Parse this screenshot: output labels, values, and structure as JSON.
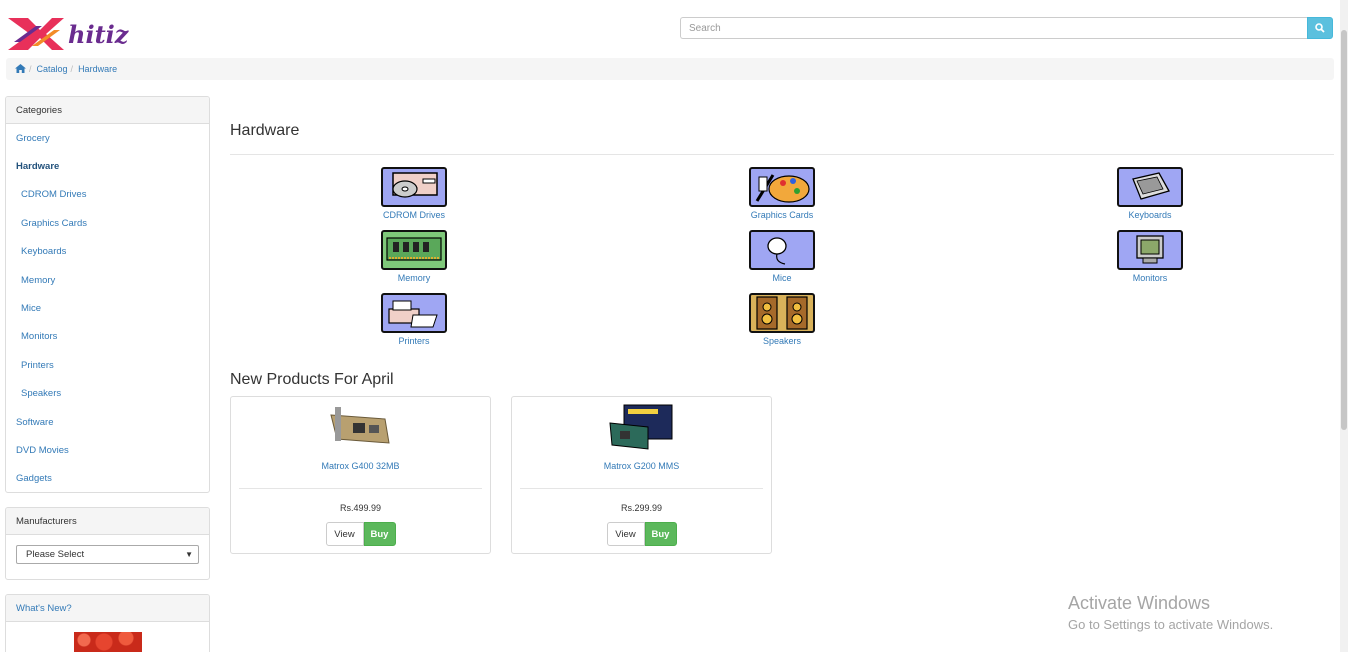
{
  "logo": {
    "text": "hitiz",
    "icon": "brand-x-logo"
  },
  "search": {
    "placeholder": "Search",
    "value": "",
    "icon": "search-icon"
  },
  "breadcrumb": {
    "home_icon": "home-icon",
    "items": [
      "Catalog",
      "Hardware"
    ]
  },
  "categories": {
    "heading": "Categories",
    "items": [
      {
        "label": "Grocery"
      },
      {
        "label": "Hardware"
      },
      {
        "label": "CDROM Drives"
      },
      {
        "label": "Graphics Cards"
      },
      {
        "label": "Keyboards"
      },
      {
        "label": "Memory"
      },
      {
        "label": "Mice"
      },
      {
        "label": "Monitors"
      },
      {
        "label": "Printers"
      },
      {
        "label": "Speakers"
      },
      {
        "label": "Software"
      },
      {
        "label": "DVD Movies"
      },
      {
        "label": "Gadgets"
      }
    ]
  },
  "manufacturers": {
    "heading": "Manufacturers",
    "selected": "Please Select"
  },
  "whats_new": {
    "heading": "What's New?"
  },
  "main": {
    "title": "Hardware",
    "subcategories": [
      {
        "label": "CDROM Drives",
        "icon": "cdrom-drive-icon"
      },
      {
        "label": "Graphics Cards",
        "icon": "graphics-card-icon"
      },
      {
        "label": "Keyboards",
        "icon": "keyboard-icon"
      },
      {
        "label": "Memory",
        "icon": "memory-icon"
      },
      {
        "label": "Mice",
        "icon": "mouse-icon"
      },
      {
        "label": "Monitors",
        "icon": "monitor-icon"
      },
      {
        "label": "Printers",
        "icon": "printer-icon"
      },
      {
        "label": "Speakers",
        "icon": "speakers-icon"
      }
    ],
    "new_products_title": "New Products For April",
    "products": [
      {
        "name": "Matrox G400 32MB",
        "price": "Rs.499.99",
        "view_label": "View",
        "buy_label": "Buy"
      },
      {
        "name": "Matrox G200 MMS",
        "price": "Rs.299.99",
        "view_label": "View",
        "buy_label": "Buy"
      }
    ]
  },
  "watermark": {
    "line1": "Activate Windows",
    "line2": "Go to Settings to activate Windows."
  },
  "colors": {
    "link": "#337ab7",
    "search_button": "#5bc0de",
    "buy_button": "#5cb85c",
    "thumb_bg": "#9fa6f3"
  }
}
